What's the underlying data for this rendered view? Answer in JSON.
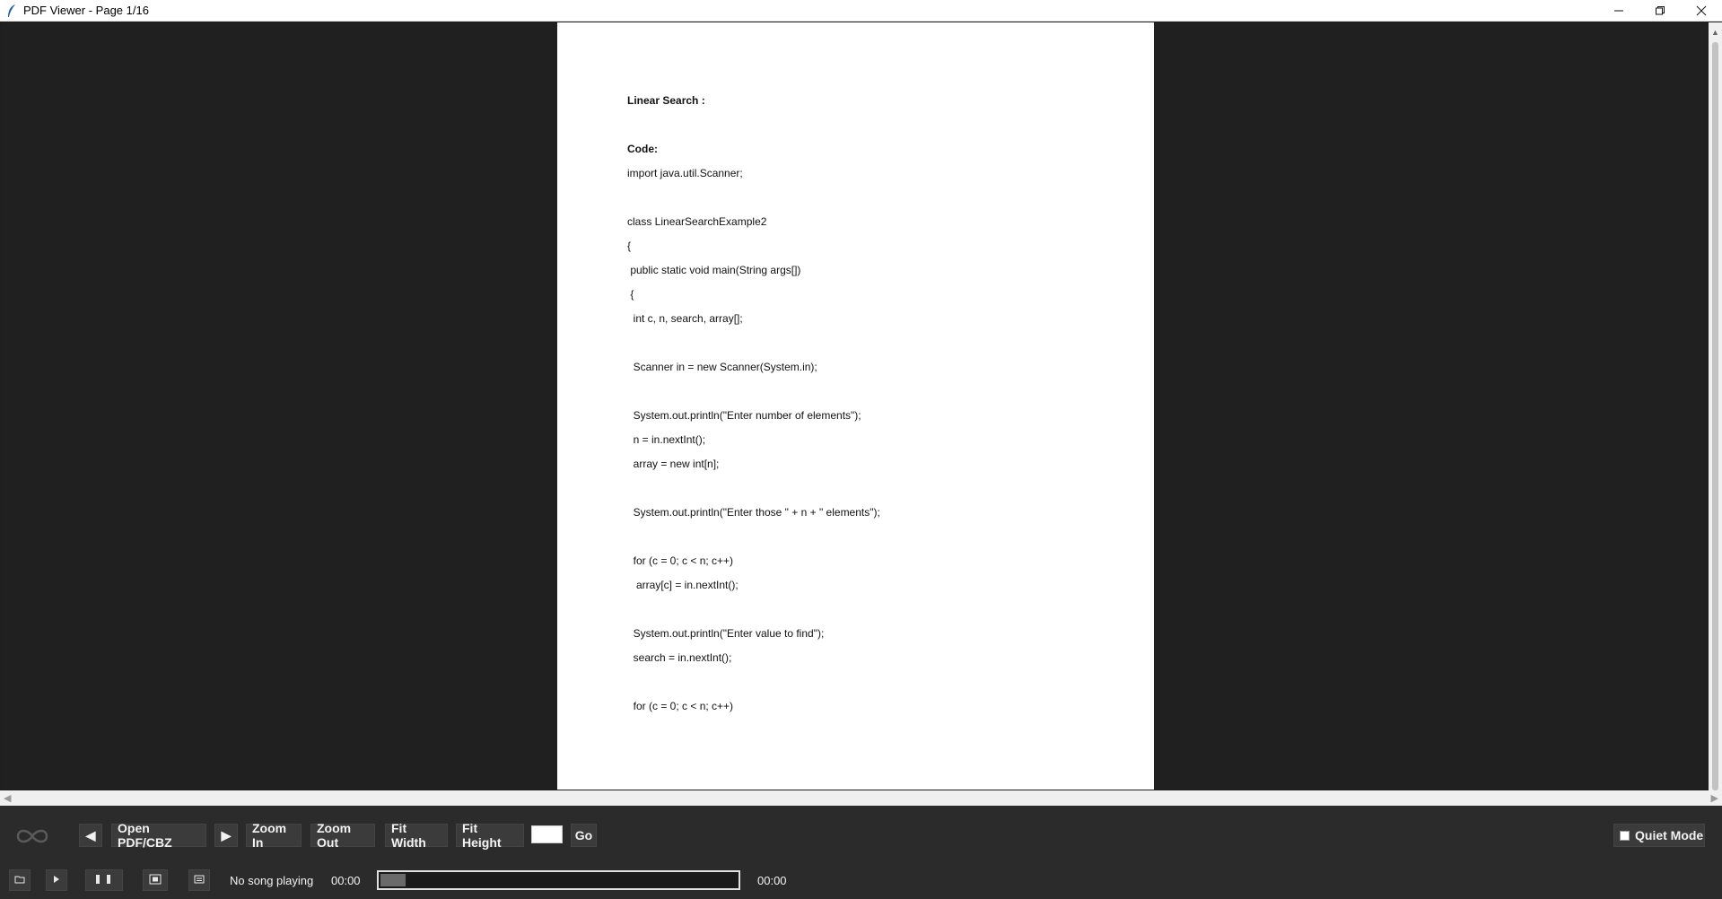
{
  "window": {
    "title": "PDF Viewer - Page 1/16",
    "controls": [
      "minimize-icon",
      "restore-icon",
      "close-icon"
    ]
  },
  "document": {
    "lines": [
      {
        "text": "Linear Search :",
        "bold": true
      },
      {
        "text": "",
        "bold": false
      },
      {
        "text": "Code:",
        "bold": true
      },
      {
        "text": "import java.util.Scanner;",
        "bold": false
      },
      {
        "text": "",
        "bold": false
      },
      {
        "text": "class LinearSearchExample2",
        "bold": false
      },
      {
        "text": "{",
        "bold": false
      },
      {
        "text": " public static void main(String args[])",
        "bold": false
      },
      {
        "text": " {",
        "bold": false
      },
      {
        "text": "  int c, n, search, array[];",
        "bold": false
      },
      {
        "text": "",
        "bold": false
      },
      {
        "text": "  Scanner in = new Scanner(System.in);",
        "bold": false
      },
      {
        "text": "",
        "bold": false
      },
      {
        "text": "  System.out.println(\"Enter number of elements\");",
        "bold": false
      },
      {
        "text": "  n = in.nextInt();",
        "bold": false
      },
      {
        "text": "  array = new int[n];",
        "bold": false
      },
      {
        "text": "",
        "bold": false
      },
      {
        "text": "  System.out.println(\"Enter those \" + n + \" elements\");",
        "bold": false
      },
      {
        "text": "",
        "bold": false
      },
      {
        "text": "  for (c = 0; c < n; c++)",
        "bold": false
      },
      {
        "text": "   array[c] = in.nextInt();",
        "bold": false
      },
      {
        "text": "",
        "bold": false
      },
      {
        "text": "  System.out.println(\"Enter value to find\");",
        "bold": false
      },
      {
        "text": "  search = in.nextInt();",
        "bold": false
      },
      {
        "text": "",
        "bold": false
      },
      {
        "text": "  for (c = 0; c < n; c++)",
        "bold": false
      }
    ]
  },
  "toolbar": {
    "prev_label": "◀",
    "open_label": "Open PDF/CBZ",
    "next_label": "▶",
    "zoom_in_label": "Zoom In",
    "zoom_out_label": "Zoom Out",
    "fit_width_label": "Fit Width",
    "fit_height_label": "Fit Height",
    "page_input_value": "",
    "go_label": "Go",
    "quiet_mode_label": "Quiet Mode",
    "quiet_mode_checked": false
  },
  "player": {
    "status": "No song playing",
    "elapsed": "00:00",
    "total": "00:00",
    "progress_fraction": 0.07
  },
  "colors": {
    "background": "#202020",
    "toolbar": "#2b2b2b",
    "button": "#3b3b3b",
    "page": "#ffffff"
  }
}
